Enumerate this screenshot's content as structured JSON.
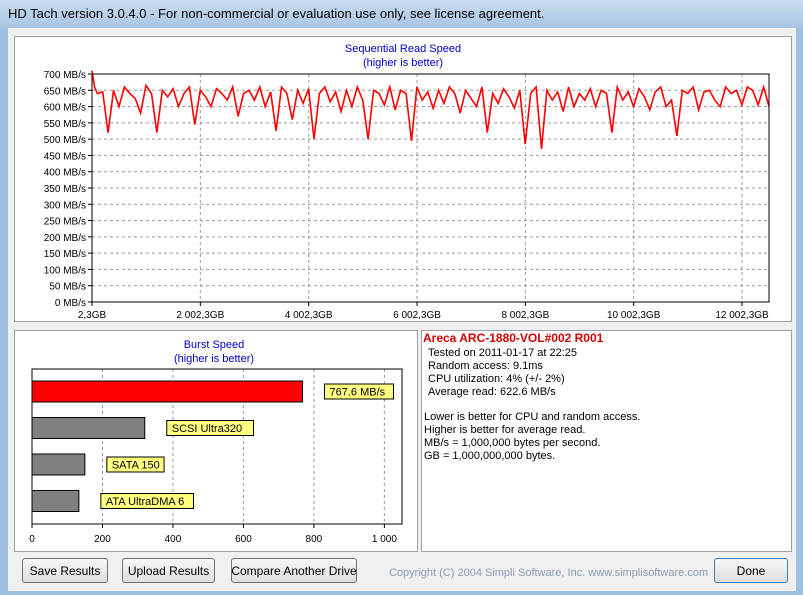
{
  "window": {
    "title": "HD Tach version 3.0.4.0  - For non-commercial or evaluation use only, see license agreement."
  },
  "sequential": {
    "title": "Sequential Read Speed",
    "subtitle": "(higher is better)",
    "y_ticks": [
      "700 MB/s",
      "650 MB/s",
      "600 MB/s",
      "550 MB/s",
      "500 MB/s",
      "450 MB/s",
      "400 MB/s",
      "350 MB/s",
      "300 MB/s",
      "250 MB/s",
      "200 MB/s",
      "150 MB/s",
      "100 MB/s",
      "50 MB/s",
      "0 MB/s"
    ],
    "x_ticks": [
      "2,3GB",
      "2 002,3GB",
      "4 002,3GB",
      "6 002,3GB",
      "8 002,3GB",
      "10 002,3GB",
      "12 002,3GB"
    ],
    "line_color": "#ff0000"
  },
  "burst": {
    "title": "Burst Speed",
    "subtitle": "(higher is better)",
    "x_ticks": [
      "0",
      "200",
      "400",
      "600",
      "800",
      "1 000"
    ]
  },
  "chart_data": [
    {
      "type": "line",
      "title": "Sequential Read Speed",
      "subtitle": "(higher is better)",
      "xlabel": "",
      "ylabel": "",
      "xlim": [
        2.3,
        12500
      ],
      "ylim": [
        0,
        700
      ],
      "grid": true,
      "series": [
        {
          "x": [
            2,
            50,
            100,
            200,
            300,
            400,
            500,
            600,
            700,
            800,
            900,
            1000,
            1100,
            1200,
            1300,
            1400,
            1500,
            1600,
            1700,
            1800,
            1900,
            2000,
            2100,
            2200,
            2300,
            2400,
            2500,
            2600,
            2700,
            2800,
            2900,
            3000,
            3100,
            3200,
            3300,
            3400,
            3500,
            3600,
            3700,
            3800,
            3900,
            4000,
            4100,
            4200,
            4300,
            4400,
            4500,
            4600,
            4700,
            4800,
            4900,
            5000,
            5100,
            5200,
            5300,
            5400,
            5500,
            5600,
            5700,
            5800,
            5900,
            6000,
            6100,
            6200,
            6300,
            6400,
            6500,
            6600,
            6700,
            6800,
            6900,
            7000,
            7100,
            7200,
            7300,
            7400,
            7500,
            7600,
            7700,
            7800,
            7900,
            8000,
            8100,
            8200,
            8300,
            8400,
            8500,
            8600,
            8700,
            8800,
            8900,
            9000,
            9100,
            9200,
            9300,
            9400,
            9500,
            9600,
            9700,
            9800,
            9900,
            10000,
            10100,
            10200,
            10300,
            10400,
            10500,
            10600,
            10700,
            10800,
            10900,
            11000,
            11100,
            11200,
            11300,
            11400,
            11500,
            11600,
            11700,
            11800,
            11900,
            12000,
            12100,
            12200,
            12300,
            12400,
            12500
          ],
          "values": [
            710,
            660,
            640,
            645,
            520,
            650,
            600,
            660,
            640,
            625,
            580,
            665,
            640,
            520,
            650,
            630,
            655,
            600,
            640,
            660,
            545,
            650,
            630,
            600,
            655,
            640,
            620,
            660,
            570,
            640,
            650,
            620,
            660,
            600,
            645,
            525,
            660,
            640,
            560,
            650,
            610,
            655,
            500,
            640,
            660,
            615,
            645,
            585,
            650,
            600,
            660,
            620,
            500,
            650,
            640,
            605,
            660,
            590,
            650,
            640,
            495,
            660,
            620,
            645,
            595,
            650,
            610,
            660,
            640,
            580,
            650,
            625,
            600,
            660,
            520,
            640,
            610,
            655,
            630,
            595,
            650,
            485,
            640,
            660,
            470,
            650,
            620,
            645,
            585,
            660,
            600,
            640,
            620,
            655,
            600,
            650,
            640,
            520,
            660,
            620,
            645,
            600,
            655,
            630,
            590,
            645,
            660,
            600,
            620,
            510,
            650,
            640,
            660,
            590,
            645,
            650,
            620,
            600,
            660,
            640,
            650,
            605,
            660,
            650,
            605,
            660,
            600
          ]
        }
      ]
    },
    {
      "type": "bar",
      "title": "Burst Speed",
      "subtitle": "(higher is better)",
      "xlim": [
        0,
        1050
      ],
      "grid": true,
      "categories": [
        "",
        "SCSI Ultra320",
        "SATA 150",
        "ATA UltraDMA 6"
      ],
      "values": [
        767.6,
        320,
        150,
        133
      ],
      "value_labels": [
        "767.6 MB/s",
        "SCSI Ultra320",
        "SATA 150",
        "ATA UltraDMA 6"
      ],
      "colors": [
        "#ff0000",
        "#808080",
        "#808080",
        "#808080"
      ]
    }
  ],
  "info": {
    "drive_name": "Areca ARC-1880-VOL#002 R001",
    "tested_on": "Tested on 2011-01-17 at 22:25",
    "random_access": "Random access: 9.1ms",
    "cpu_util": "CPU utilization: 4% (+/- 2%)",
    "avg_read": "Average read: 622.6 MB/s",
    "note1": "Lower is better for CPU and random access.",
    "note2": "Higher is better for average read.",
    "note3": "MB/s = 1,000,000 bytes per second.",
    "note4": "GB = 1,000,000,000 bytes."
  },
  "buttons": {
    "save": "Save Results",
    "upload": "Upload Results",
    "compare": "Compare Another Drive",
    "done": "Done"
  },
  "footer": {
    "copyright": "Copyright (C) 2004 Simpli Software, Inc. www.simplisoftware.com"
  }
}
